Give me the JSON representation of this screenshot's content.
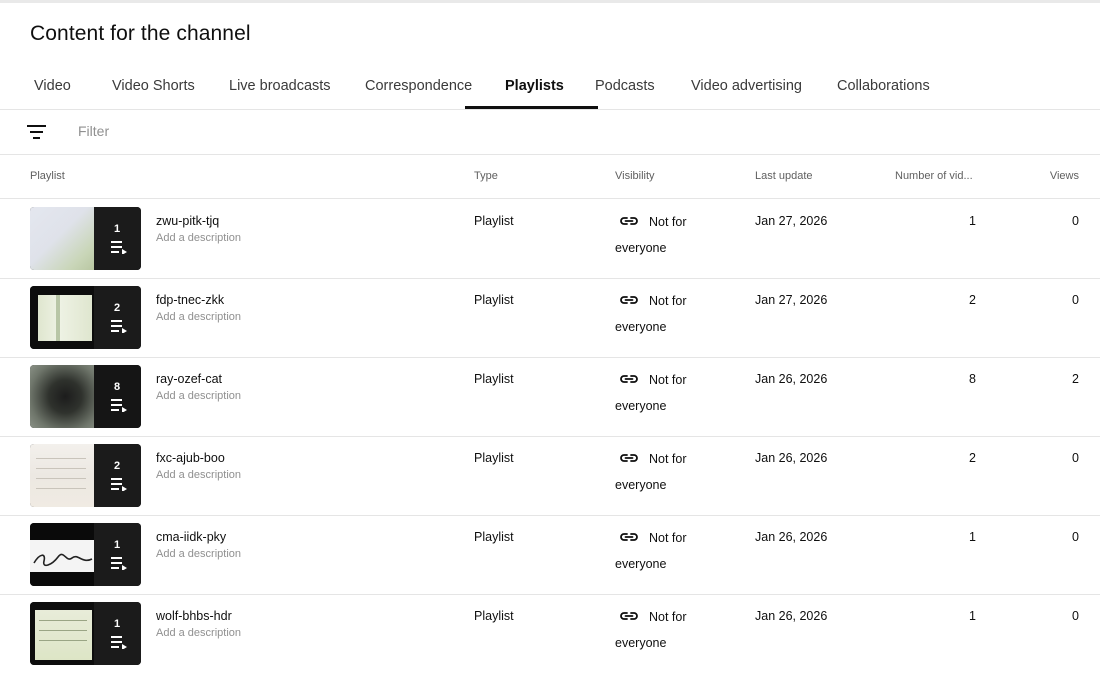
{
  "page_title": "Content for the channel",
  "tabs": [
    {
      "label": "Video",
      "active": false
    },
    {
      "label": "Video Shorts",
      "active": false
    },
    {
      "label": "Live broadcasts",
      "active": false
    },
    {
      "label": "Correspondence",
      "active": false
    },
    {
      "label": "Playlists",
      "active": true
    },
    {
      "label": "Podcasts",
      "active": false
    },
    {
      "label": "Video advertising",
      "active": false
    },
    {
      "label": "Collaborations",
      "active": false
    }
  ],
  "filter": {
    "icon": "filter-icon",
    "placeholder": "Filter"
  },
  "table": {
    "columns": {
      "playlist": "Playlist",
      "type": "Type",
      "visibility": "Visibility",
      "last_update": "Last update",
      "num_videos": "Number of vid...",
      "views": "Views"
    },
    "rows": [
      {
        "title": "zwu-pitk-tjq",
        "description": "Add a description",
        "count": "1",
        "type": "Playlist",
        "visibility_line1": "Not for",
        "visibility_line2": "everyone",
        "last_update": "Jan 27, 2026",
        "num_videos": "1",
        "views": "0",
        "visibility_icon": "link-icon"
      },
      {
        "title": "fdp-tnec-zkk",
        "description": "Add a description",
        "count": "2",
        "type": "Playlist",
        "visibility_line1": "Not for",
        "visibility_line2": "everyone",
        "last_update": "Jan 27, 2026",
        "num_videos": "2",
        "views": "0",
        "visibility_icon": "link-icon"
      },
      {
        "title": "ray-ozef-cat",
        "description": "Add a description",
        "count": "8",
        "type": "Playlist",
        "visibility_line1": "Not for",
        "visibility_line2": "everyone",
        "last_update": "Jan 26, 2026",
        "num_videos": "8",
        "views": "2",
        "visibility_icon": "link-icon"
      },
      {
        "title": "fxc-ajub-boo",
        "description": "Add a description",
        "count": "2",
        "type": "Playlist",
        "visibility_line1": "Not for",
        "visibility_line2": "everyone",
        "last_update": "Jan 26, 2026",
        "num_videos": "2",
        "views": "0",
        "visibility_icon": "link-icon"
      },
      {
        "title": "cma-iidk-pky",
        "description": "Add a description",
        "count": "1",
        "type": "Playlist",
        "visibility_line1": "Not for",
        "visibility_line2": "everyone",
        "last_update": "Jan 26, 2026",
        "num_videos": "1",
        "views": "0",
        "visibility_icon": "link-icon"
      },
      {
        "title": "wolf-bhbs-hdr",
        "description": "Add a description",
        "count": "1",
        "type": "Playlist",
        "visibility_line1": "Not for",
        "visibility_line2": "everyone",
        "last_update": "Jan 26, 2026",
        "num_videos": "1",
        "views": "0",
        "visibility_icon": "link-icon"
      }
    ]
  }
}
